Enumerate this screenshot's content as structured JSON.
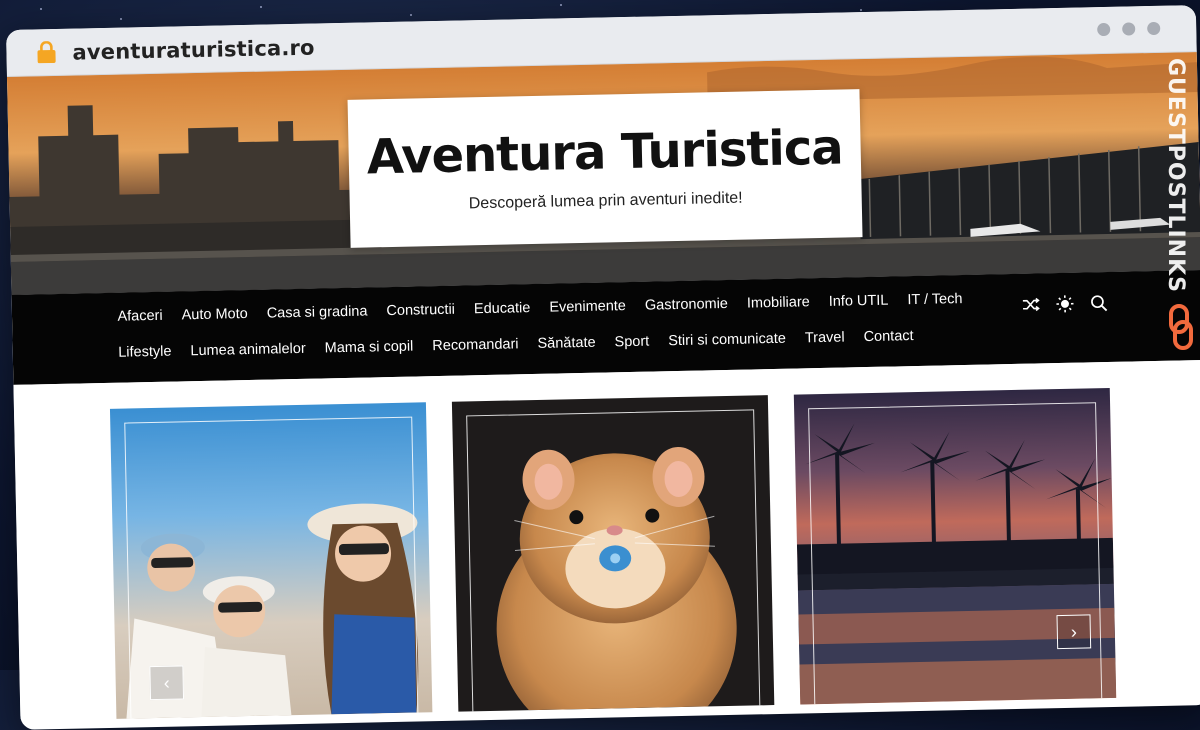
{
  "browser": {
    "url": "aventuraturistica.ro"
  },
  "site": {
    "title": "Aventura Turistica",
    "tagline": "Descoperă lumea prin aventuri inedite!"
  },
  "nav": {
    "row1": [
      "Afaceri",
      "Auto Moto",
      "Casa si gradina",
      "Constructii",
      "Educatie",
      "Evenimente",
      "Gastronomie",
      "Imobiliare",
      "Info UTIL",
      "IT / Tech"
    ],
    "row2": [
      "Lifestyle",
      "Lumea animalelor",
      "Mama si copil",
      "Recomandari",
      "Sănătate",
      "Sport",
      "Stiri si comunicate",
      "Travel",
      "Contact"
    ],
    "tools": [
      "shuffle-icon",
      "sun-icon",
      "search-icon"
    ]
  },
  "slider": {
    "prev_arrow": "‹",
    "next_arrow": "›"
  },
  "watermark": {
    "text": "GUESTPOSTLINKS"
  },
  "colors": {
    "nav_bg": "#050505",
    "brand_orange": "#f26a3d"
  }
}
